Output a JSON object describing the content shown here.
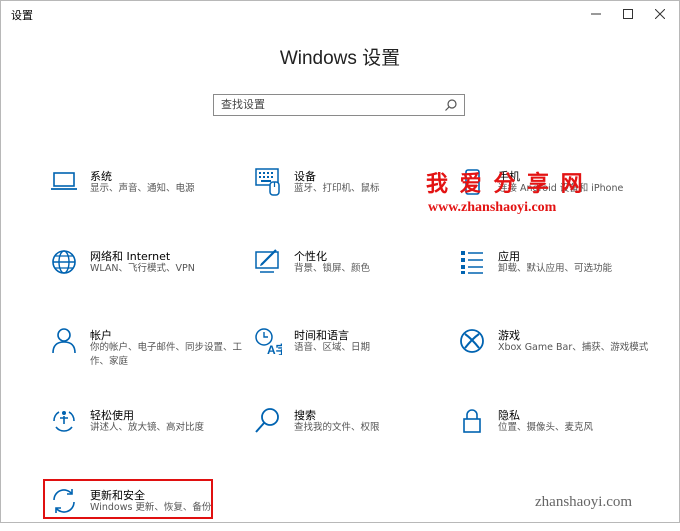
{
  "window": {
    "title": "设置",
    "minimize": "—",
    "maximize": "☐",
    "close": "✕"
  },
  "heading": "Windows 设置",
  "search": {
    "placeholder": "查找设置",
    "value": ""
  },
  "items": [
    {
      "name": "系统",
      "desc": "显示、声音、通知、电源",
      "icon": "laptop-icon"
    },
    {
      "name": "设备",
      "desc": "蓝牙、打印机、鼠标",
      "icon": "keyboard-icon"
    },
    {
      "name": "手机",
      "desc": "连接 Android 设备和 iPhone",
      "icon": "phone-icon"
    },
    {
      "name": "网络和 Internet",
      "desc": "WLAN、飞行模式、VPN",
      "icon": "globe-icon"
    },
    {
      "name": "个性化",
      "desc": "背景、锁屏、颜色",
      "icon": "paint-icon"
    },
    {
      "name": "应用",
      "desc": "卸载、默认应用、可选功能",
      "icon": "apps-list-icon"
    },
    {
      "name": "帐户",
      "desc": "你的帐户、电子邮件、同步设置、工作、家庭",
      "icon": "person-icon"
    },
    {
      "name": "时间和语言",
      "desc": "语音、区域、日期",
      "icon": "time-language-icon"
    },
    {
      "name": "游戏",
      "desc": "Xbox Game Bar、捕获、游戏模式",
      "icon": "xbox-icon"
    },
    {
      "name": "轻松使用",
      "desc": "讲述人、放大镜、高对比度",
      "icon": "ease-of-access-icon"
    },
    {
      "name": "搜索",
      "desc": "查找我的文件、权限",
      "icon": "search-icon"
    },
    {
      "name": "隐私",
      "desc": "位置、摄像头、麦克风",
      "icon": "lock-icon"
    },
    {
      "name": "更新和安全",
      "desc": "Windows 更新、恢复、备份",
      "icon": "sync-icon"
    }
  ],
  "watermark": {
    "line1": "我 爱 分 享 网",
    "line2": "www.zhanshaoyi.com",
    "bottom": "zhanshaoyi.com"
  },
  "colors": {
    "accent": "#0063b1",
    "highlight": "#e01010",
    "watermark": "#e31313"
  }
}
